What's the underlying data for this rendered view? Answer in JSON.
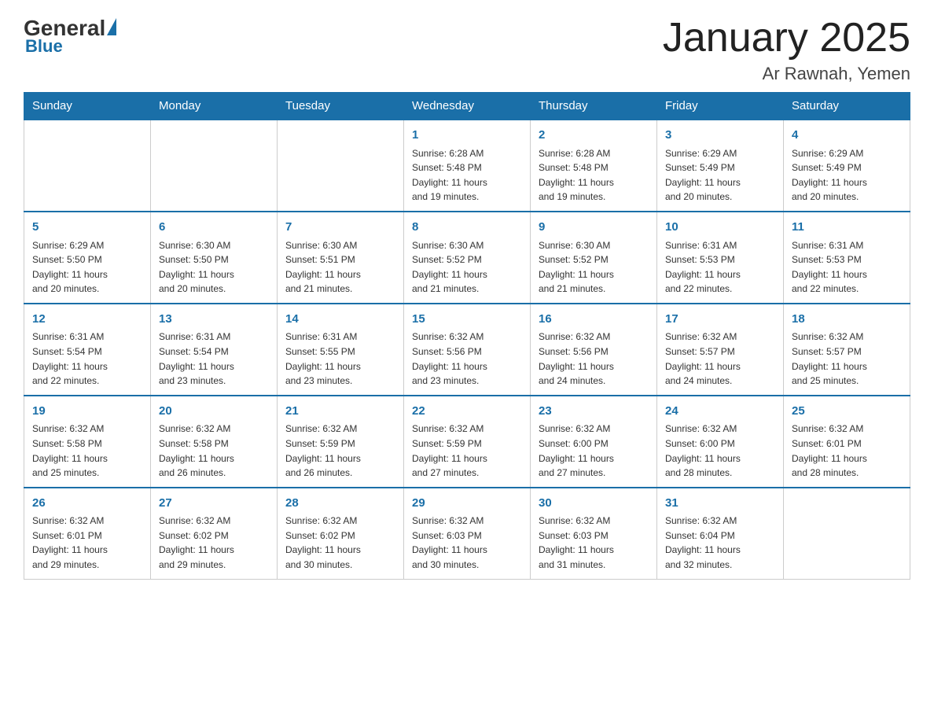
{
  "logo": {
    "general": "General",
    "blue": "Blue",
    "subtitle": "Blue"
  },
  "title": "January 2025",
  "subtitle": "Ar Rawnah, Yemen",
  "days_header": [
    "Sunday",
    "Monday",
    "Tuesday",
    "Wednesday",
    "Thursday",
    "Friday",
    "Saturday"
  ],
  "weeks": [
    [
      {
        "day": "",
        "info": ""
      },
      {
        "day": "",
        "info": ""
      },
      {
        "day": "",
        "info": ""
      },
      {
        "day": "1",
        "info": "Sunrise: 6:28 AM\nSunset: 5:48 PM\nDaylight: 11 hours\nand 19 minutes."
      },
      {
        "day": "2",
        "info": "Sunrise: 6:28 AM\nSunset: 5:48 PM\nDaylight: 11 hours\nand 19 minutes."
      },
      {
        "day": "3",
        "info": "Sunrise: 6:29 AM\nSunset: 5:49 PM\nDaylight: 11 hours\nand 20 minutes."
      },
      {
        "day": "4",
        "info": "Sunrise: 6:29 AM\nSunset: 5:49 PM\nDaylight: 11 hours\nand 20 minutes."
      }
    ],
    [
      {
        "day": "5",
        "info": "Sunrise: 6:29 AM\nSunset: 5:50 PM\nDaylight: 11 hours\nand 20 minutes."
      },
      {
        "day": "6",
        "info": "Sunrise: 6:30 AM\nSunset: 5:50 PM\nDaylight: 11 hours\nand 20 minutes."
      },
      {
        "day": "7",
        "info": "Sunrise: 6:30 AM\nSunset: 5:51 PM\nDaylight: 11 hours\nand 21 minutes."
      },
      {
        "day": "8",
        "info": "Sunrise: 6:30 AM\nSunset: 5:52 PM\nDaylight: 11 hours\nand 21 minutes."
      },
      {
        "day": "9",
        "info": "Sunrise: 6:30 AM\nSunset: 5:52 PM\nDaylight: 11 hours\nand 21 minutes."
      },
      {
        "day": "10",
        "info": "Sunrise: 6:31 AM\nSunset: 5:53 PM\nDaylight: 11 hours\nand 22 minutes."
      },
      {
        "day": "11",
        "info": "Sunrise: 6:31 AM\nSunset: 5:53 PM\nDaylight: 11 hours\nand 22 minutes."
      }
    ],
    [
      {
        "day": "12",
        "info": "Sunrise: 6:31 AM\nSunset: 5:54 PM\nDaylight: 11 hours\nand 22 minutes."
      },
      {
        "day": "13",
        "info": "Sunrise: 6:31 AM\nSunset: 5:54 PM\nDaylight: 11 hours\nand 23 minutes."
      },
      {
        "day": "14",
        "info": "Sunrise: 6:31 AM\nSunset: 5:55 PM\nDaylight: 11 hours\nand 23 minutes."
      },
      {
        "day": "15",
        "info": "Sunrise: 6:32 AM\nSunset: 5:56 PM\nDaylight: 11 hours\nand 23 minutes."
      },
      {
        "day": "16",
        "info": "Sunrise: 6:32 AM\nSunset: 5:56 PM\nDaylight: 11 hours\nand 24 minutes."
      },
      {
        "day": "17",
        "info": "Sunrise: 6:32 AM\nSunset: 5:57 PM\nDaylight: 11 hours\nand 24 minutes."
      },
      {
        "day": "18",
        "info": "Sunrise: 6:32 AM\nSunset: 5:57 PM\nDaylight: 11 hours\nand 25 minutes."
      }
    ],
    [
      {
        "day": "19",
        "info": "Sunrise: 6:32 AM\nSunset: 5:58 PM\nDaylight: 11 hours\nand 25 minutes."
      },
      {
        "day": "20",
        "info": "Sunrise: 6:32 AM\nSunset: 5:58 PM\nDaylight: 11 hours\nand 26 minutes."
      },
      {
        "day": "21",
        "info": "Sunrise: 6:32 AM\nSunset: 5:59 PM\nDaylight: 11 hours\nand 26 minutes."
      },
      {
        "day": "22",
        "info": "Sunrise: 6:32 AM\nSunset: 5:59 PM\nDaylight: 11 hours\nand 27 minutes."
      },
      {
        "day": "23",
        "info": "Sunrise: 6:32 AM\nSunset: 6:00 PM\nDaylight: 11 hours\nand 27 minutes."
      },
      {
        "day": "24",
        "info": "Sunrise: 6:32 AM\nSunset: 6:00 PM\nDaylight: 11 hours\nand 28 minutes."
      },
      {
        "day": "25",
        "info": "Sunrise: 6:32 AM\nSunset: 6:01 PM\nDaylight: 11 hours\nand 28 minutes."
      }
    ],
    [
      {
        "day": "26",
        "info": "Sunrise: 6:32 AM\nSunset: 6:01 PM\nDaylight: 11 hours\nand 29 minutes."
      },
      {
        "day": "27",
        "info": "Sunrise: 6:32 AM\nSunset: 6:02 PM\nDaylight: 11 hours\nand 29 minutes."
      },
      {
        "day": "28",
        "info": "Sunrise: 6:32 AM\nSunset: 6:02 PM\nDaylight: 11 hours\nand 30 minutes."
      },
      {
        "day": "29",
        "info": "Sunrise: 6:32 AM\nSunset: 6:03 PM\nDaylight: 11 hours\nand 30 minutes."
      },
      {
        "day": "30",
        "info": "Sunrise: 6:32 AM\nSunset: 6:03 PM\nDaylight: 11 hours\nand 31 minutes."
      },
      {
        "day": "31",
        "info": "Sunrise: 6:32 AM\nSunset: 6:04 PM\nDaylight: 11 hours\nand 32 minutes."
      },
      {
        "day": "",
        "info": ""
      }
    ]
  ]
}
